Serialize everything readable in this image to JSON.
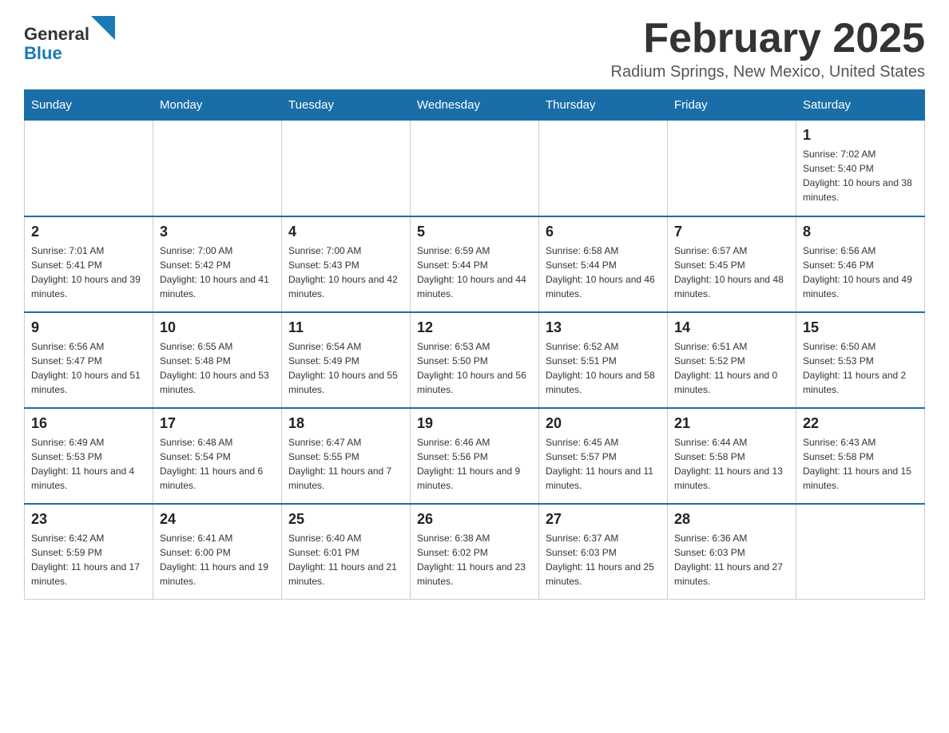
{
  "header": {
    "logo_text_general": "General",
    "logo_text_blue": "Blue",
    "month_title": "February 2025",
    "location": "Radium Springs, New Mexico, United States"
  },
  "weekdays": [
    "Sunday",
    "Monday",
    "Tuesday",
    "Wednesday",
    "Thursday",
    "Friday",
    "Saturday"
  ],
  "weeks": [
    [
      {
        "day": "",
        "info": ""
      },
      {
        "day": "",
        "info": ""
      },
      {
        "day": "",
        "info": ""
      },
      {
        "day": "",
        "info": ""
      },
      {
        "day": "",
        "info": ""
      },
      {
        "day": "",
        "info": ""
      },
      {
        "day": "1",
        "info": "Sunrise: 7:02 AM\nSunset: 5:40 PM\nDaylight: 10 hours and 38 minutes."
      }
    ],
    [
      {
        "day": "2",
        "info": "Sunrise: 7:01 AM\nSunset: 5:41 PM\nDaylight: 10 hours and 39 minutes."
      },
      {
        "day": "3",
        "info": "Sunrise: 7:00 AM\nSunset: 5:42 PM\nDaylight: 10 hours and 41 minutes."
      },
      {
        "day": "4",
        "info": "Sunrise: 7:00 AM\nSunset: 5:43 PM\nDaylight: 10 hours and 42 minutes."
      },
      {
        "day": "5",
        "info": "Sunrise: 6:59 AM\nSunset: 5:44 PM\nDaylight: 10 hours and 44 minutes."
      },
      {
        "day": "6",
        "info": "Sunrise: 6:58 AM\nSunset: 5:44 PM\nDaylight: 10 hours and 46 minutes."
      },
      {
        "day": "7",
        "info": "Sunrise: 6:57 AM\nSunset: 5:45 PM\nDaylight: 10 hours and 48 minutes."
      },
      {
        "day": "8",
        "info": "Sunrise: 6:56 AM\nSunset: 5:46 PM\nDaylight: 10 hours and 49 minutes."
      }
    ],
    [
      {
        "day": "9",
        "info": "Sunrise: 6:56 AM\nSunset: 5:47 PM\nDaylight: 10 hours and 51 minutes."
      },
      {
        "day": "10",
        "info": "Sunrise: 6:55 AM\nSunset: 5:48 PM\nDaylight: 10 hours and 53 minutes."
      },
      {
        "day": "11",
        "info": "Sunrise: 6:54 AM\nSunset: 5:49 PM\nDaylight: 10 hours and 55 minutes."
      },
      {
        "day": "12",
        "info": "Sunrise: 6:53 AM\nSunset: 5:50 PM\nDaylight: 10 hours and 56 minutes."
      },
      {
        "day": "13",
        "info": "Sunrise: 6:52 AM\nSunset: 5:51 PM\nDaylight: 10 hours and 58 minutes."
      },
      {
        "day": "14",
        "info": "Sunrise: 6:51 AM\nSunset: 5:52 PM\nDaylight: 11 hours and 0 minutes."
      },
      {
        "day": "15",
        "info": "Sunrise: 6:50 AM\nSunset: 5:53 PM\nDaylight: 11 hours and 2 minutes."
      }
    ],
    [
      {
        "day": "16",
        "info": "Sunrise: 6:49 AM\nSunset: 5:53 PM\nDaylight: 11 hours and 4 minutes."
      },
      {
        "day": "17",
        "info": "Sunrise: 6:48 AM\nSunset: 5:54 PM\nDaylight: 11 hours and 6 minutes."
      },
      {
        "day": "18",
        "info": "Sunrise: 6:47 AM\nSunset: 5:55 PM\nDaylight: 11 hours and 7 minutes."
      },
      {
        "day": "19",
        "info": "Sunrise: 6:46 AM\nSunset: 5:56 PM\nDaylight: 11 hours and 9 minutes."
      },
      {
        "day": "20",
        "info": "Sunrise: 6:45 AM\nSunset: 5:57 PM\nDaylight: 11 hours and 11 minutes."
      },
      {
        "day": "21",
        "info": "Sunrise: 6:44 AM\nSunset: 5:58 PM\nDaylight: 11 hours and 13 minutes."
      },
      {
        "day": "22",
        "info": "Sunrise: 6:43 AM\nSunset: 5:58 PM\nDaylight: 11 hours and 15 minutes."
      }
    ],
    [
      {
        "day": "23",
        "info": "Sunrise: 6:42 AM\nSunset: 5:59 PM\nDaylight: 11 hours and 17 minutes."
      },
      {
        "day": "24",
        "info": "Sunrise: 6:41 AM\nSunset: 6:00 PM\nDaylight: 11 hours and 19 minutes."
      },
      {
        "day": "25",
        "info": "Sunrise: 6:40 AM\nSunset: 6:01 PM\nDaylight: 11 hours and 21 minutes."
      },
      {
        "day": "26",
        "info": "Sunrise: 6:38 AM\nSunset: 6:02 PM\nDaylight: 11 hours and 23 minutes."
      },
      {
        "day": "27",
        "info": "Sunrise: 6:37 AM\nSunset: 6:03 PM\nDaylight: 11 hours and 25 minutes."
      },
      {
        "day": "28",
        "info": "Sunrise: 6:36 AM\nSunset: 6:03 PM\nDaylight: 11 hours and 27 minutes."
      },
      {
        "day": "",
        "info": ""
      }
    ]
  ]
}
